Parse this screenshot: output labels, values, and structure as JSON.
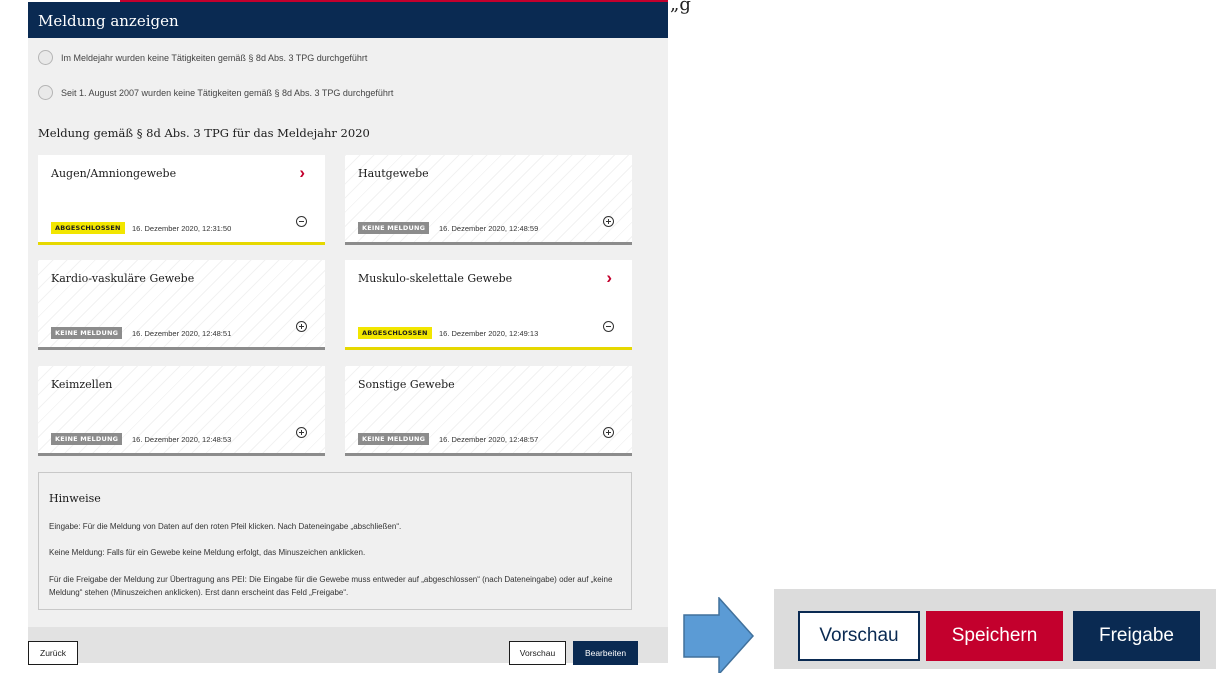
{
  "top_fragment": "„g",
  "dialog": {
    "title": "Meldung anzeigen",
    "radio_1": "Im Meldejahr wurden keine Tätigkeiten gemäß § 8d Abs. 3 TPG durchgeführt",
    "radio_2": "Seit 1. August 2007 wurden keine Tätigkeiten gemäß § 8d Abs. 3 TPG durchgeführt",
    "section_title": "Meldung gemäß § 8d Abs. 3 TPG für das Meldejahr 2020"
  },
  "cards": [
    {
      "title": "Augen/Amniongewebe",
      "status": "ABGESCHLOSSEN",
      "timestamp": "16. Dezember 2020, 12:31:50",
      "has_arrow": true,
      "toggle": "minus"
    },
    {
      "title": "Hautgewebe",
      "status": "KEINE MELDUNG",
      "timestamp": "16. Dezember 2020, 12:48:59",
      "has_arrow": false,
      "toggle": "plus"
    },
    {
      "title": "Kardio-vaskuläre Gewebe",
      "status": "KEINE MELDUNG",
      "timestamp": "16. Dezember 2020, 12:48:51",
      "has_arrow": false,
      "toggle": "plus"
    },
    {
      "title": "Muskulo-skelettale Gewebe",
      "status": "ABGESCHLOSSEN",
      "timestamp": "16. Dezember 2020, 12:49:13",
      "has_arrow": true,
      "toggle": "minus"
    },
    {
      "title": "Keimzellen",
      "status": "KEINE MELDUNG",
      "timestamp": "16. Dezember 2020, 12:48:53",
      "has_arrow": false,
      "toggle": "plus"
    },
    {
      "title": "Sonstige Gewebe",
      "status": "KEINE MELDUNG",
      "timestamp": "16. Dezember 2020, 12:48:57",
      "has_arrow": false,
      "toggle": "plus"
    }
  ],
  "arrow_glyph": "›",
  "hints": {
    "title": "Hinweise",
    "line_1": "Eingabe: Für die Meldung von Daten auf den roten Pfeil klicken. Nach Dateneingabe „abschließen“.",
    "line_2": "Keine Meldung: Falls für ein Gewebe keine Meldung erfolgt, das Minuszeichen anklicken.",
    "line_3": "Für die Freigabe der Meldung zur Übertragung ans PEI: Die Eingabe für die Gewebe muss entweder auf „abgeschlossen“ (nach Dateneingabe) oder auf „keine Meldung“ stehen (Minuszeichen anklicken). Erst dann erscheint das Feld „Freigabe“."
  },
  "footer": {
    "back": "Zurück",
    "preview": "Vorschau",
    "edit": "Bearbeiten"
  },
  "big_buttons": {
    "preview": "Vorschau",
    "save": "Speichern",
    "release": "Freigabe"
  },
  "colors": {
    "navy": "#0a2a52",
    "red": "#c3002d",
    "yellow": "#f2e600",
    "gray_badge": "#8c8c8c",
    "arrow_blue": "#5b9bd5"
  }
}
